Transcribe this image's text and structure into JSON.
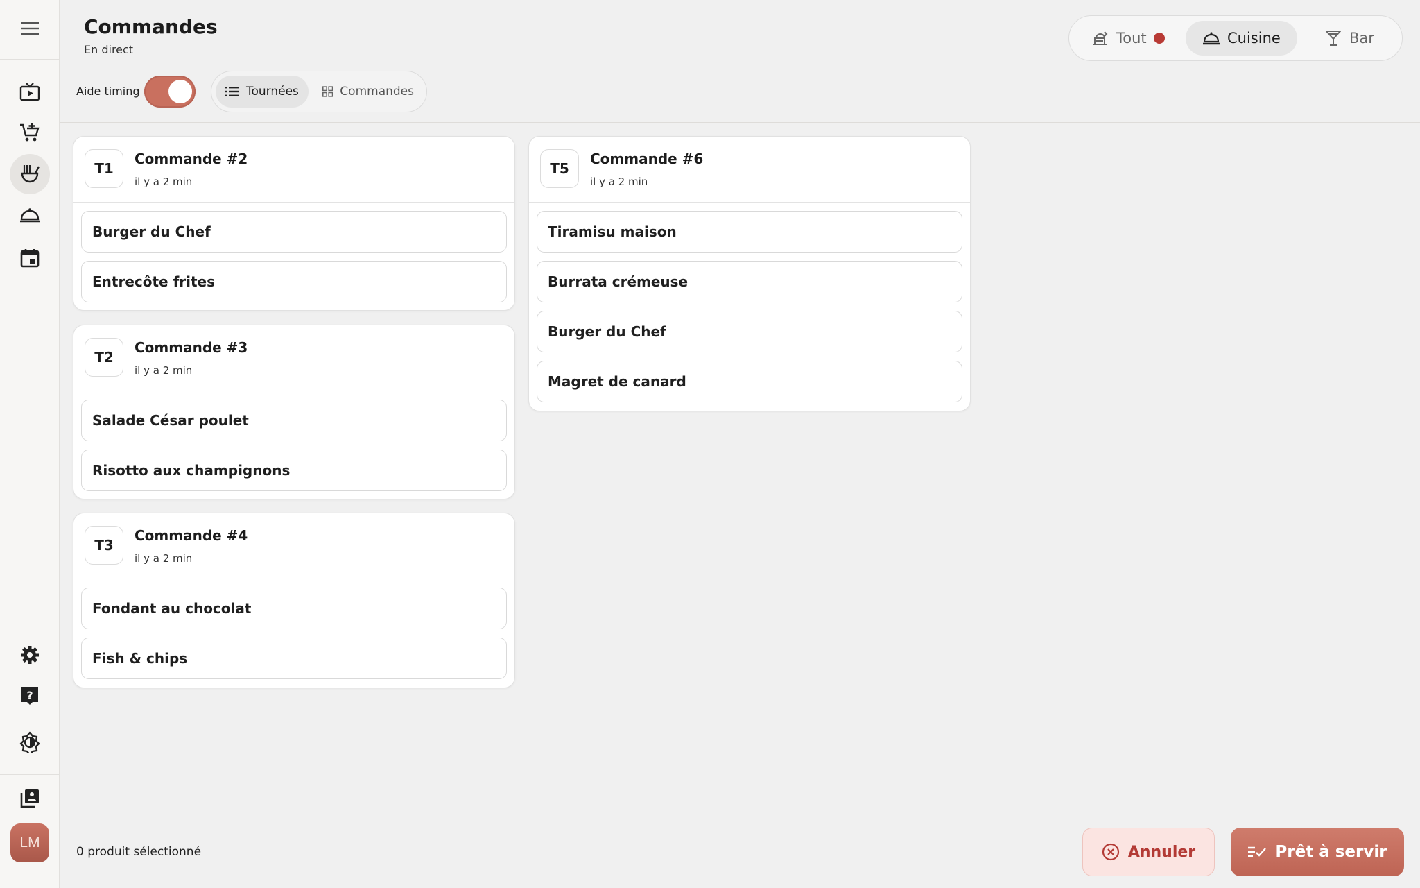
{
  "header": {
    "title": "Commandes",
    "subtitle": "En direct",
    "timing_label": "Aide timing",
    "timing_enabled": true,
    "view_tabs": [
      {
        "label": "Tournées",
        "icon": "list-icon",
        "active": true
      },
      {
        "label": "Commandes",
        "icon": "grid-icon",
        "active": false
      }
    ],
    "stations": [
      {
        "label": "Tout",
        "icon": "dishes-icon",
        "active": false,
        "alert": true
      },
      {
        "label": "Cuisine",
        "icon": "cloche-icon",
        "active": true
      },
      {
        "label": "Bar",
        "icon": "cocktail-icon",
        "active": false
      }
    ]
  },
  "sidebar": {
    "items": [
      {
        "icon": "menu-icon"
      },
      {
        "icon": "live-tv-icon"
      },
      {
        "icon": "add-cart-icon"
      },
      {
        "icon": "kitchen-ladle-icon",
        "active": true
      },
      {
        "icon": "cloche-icon"
      },
      {
        "icon": "calendar-icon"
      },
      {
        "icon": "settings-icon"
      },
      {
        "icon": "help-icon"
      },
      {
        "icon": "brightness-icon"
      },
      {
        "icon": "library-icon"
      }
    ],
    "avatar_initials": "LM"
  },
  "orders": [
    {
      "table": "T1",
      "title": "Commande #2",
      "time": "il y a 2 min",
      "items": [
        "Burger du Chef",
        "Entrecôte frites"
      ]
    },
    {
      "table": "T2",
      "title": "Commande #3",
      "time": "il y a 2 min",
      "items": [
        "Salade César poulet",
        "Risotto aux champignons"
      ]
    },
    {
      "table": "T3",
      "title": "Commande #4",
      "time": "il y a 2 min",
      "items": [
        "Fondant au chocolat",
        "Fish & chips"
      ]
    },
    {
      "table": "T5",
      "title": "Commande #6",
      "time": "il y a 2 min",
      "items": [
        "Tiramisu maison",
        "Burrata crémeuse",
        "Burger du Chef",
        "Magret de canard"
      ]
    }
  ],
  "footer": {
    "selection_text": "0 produit sélectionné",
    "cancel_label": "Annuler",
    "ready_label": "Prêt à servir"
  },
  "colors": {
    "accent": "#c9705f",
    "danger": "#b33a35",
    "alert_dot": "#b83a35"
  }
}
